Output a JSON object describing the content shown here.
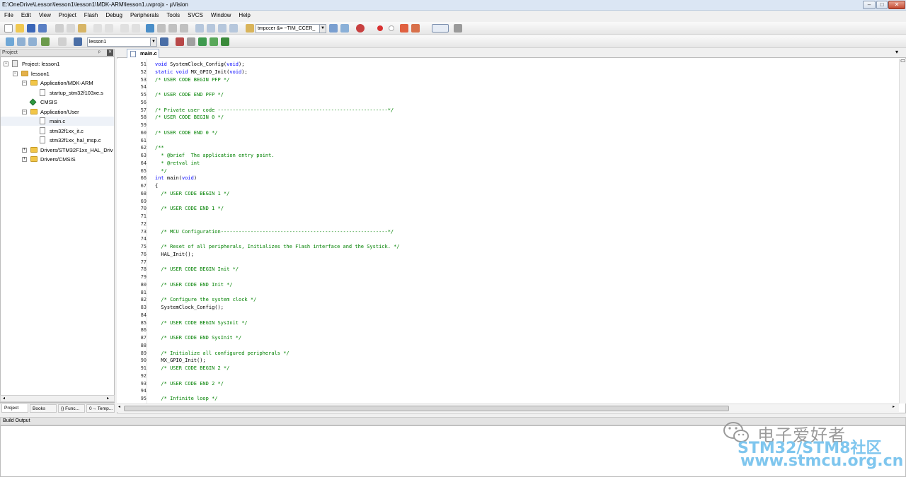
{
  "window": {
    "title": "E:\\OneDrive\\Lesson\\lesson1\\lesson1\\MDK-ARM\\lesson1.uvprojx - µVision",
    "min": "–",
    "max": "□",
    "close": "✕"
  },
  "menu": [
    "File",
    "Edit",
    "View",
    "Project",
    "Flash",
    "Debug",
    "Peripherals",
    "Tools",
    "SVCS",
    "Window",
    "Help"
  ],
  "toolbar": {
    "find_combo": "tmpccer &= ~TIM_CCER_",
    "target_combo": "lesson1"
  },
  "project_pane": {
    "title": "Project",
    "pin": "ᵖ",
    "close": "✕",
    "tree": [
      {
        "label": "Project: lesson1",
        "depth": 0,
        "exp": "−",
        "kind": "proj"
      },
      {
        "label": "lesson1",
        "depth": 1,
        "exp": "−",
        "kind": "target"
      },
      {
        "label": "Application/MDK-ARM",
        "depth": 2,
        "exp": "−",
        "kind": "folder"
      },
      {
        "label": "startup_stm32f103xe.s",
        "depth": 3,
        "exp": "",
        "kind": "file"
      },
      {
        "label": "CMSIS",
        "depth": 2,
        "exp": "",
        "kind": "gem"
      },
      {
        "label": "Application/User",
        "depth": 2,
        "exp": "−",
        "kind": "folder"
      },
      {
        "label": "main.c",
        "depth": 3,
        "exp": "",
        "kind": "file"
      },
      {
        "label": "stm32f1xx_it.c",
        "depth": 3,
        "exp": "",
        "kind": "file"
      },
      {
        "label": "stm32f1xx_hal_msp.c",
        "depth": 3,
        "exp": "",
        "kind": "file"
      },
      {
        "label": "Drivers/STM32F1xx_HAL_Driv",
        "depth": 2,
        "exp": "+",
        "kind": "folder"
      },
      {
        "label": "Drivers/CMSIS",
        "depth": 2,
        "exp": "+",
        "kind": "folder"
      }
    ],
    "tabs": [
      "Project",
      "Books",
      "{} Func...",
      "0→ Temp..."
    ]
  },
  "editor": {
    "tab": "main.c",
    "lines": [
      {
        "n": "51",
        "t": "void SystemClock_Config(void);",
        "c": "code"
      },
      {
        "n": "52",
        "t": "static void MX_GPIO_Init(void);",
        "c": "code"
      },
      {
        "n": "53",
        "t": "/* USER CODE BEGIN PFP */",
        "c": "cmt"
      },
      {
        "n": "54",
        "t": "",
        "c": "code"
      },
      {
        "n": "55",
        "t": "/* USER CODE END PFP */",
        "c": "cmt"
      },
      {
        "n": "56",
        "t": "",
        "c": "code"
      },
      {
        "n": "57",
        "t": "/* Private user code ---------------------------------------------------------*/",
        "c": "cmt"
      },
      {
        "n": "58",
        "t": "/* USER CODE BEGIN 0 */",
        "c": "cmt"
      },
      {
        "n": "59",
        "t": "",
        "c": "code"
      },
      {
        "n": "60",
        "t": "/* USER CODE END 0 */",
        "c": "cmt"
      },
      {
        "n": "61",
        "t": "",
        "c": "code"
      },
      {
        "n": "62",
        "t": "/**",
        "c": "cmt",
        "fold": "−"
      },
      {
        "n": "63",
        "t": "  * @brief  The application entry point.",
        "c": "cmt"
      },
      {
        "n": "64",
        "t": "  * @retval int",
        "c": "cmt"
      },
      {
        "n": "65",
        "t": "  */",
        "c": "cmt"
      },
      {
        "n": "66",
        "t": "int main(void)",
        "c": "code"
      },
      {
        "n": "67",
        "t": "{",
        "c": "code",
        "fold": "−"
      },
      {
        "n": "68",
        "t": "  /* USER CODE BEGIN 1 */",
        "c": "cmt"
      },
      {
        "n": "69",
        "t": "",
        "c": "code"
      },
      {
        "n": "70",
        "t": "  /* USER CODE END 1 */",
        "c": "cmt"
      },
      {
        "n": "71",
        "t": "",
        "c": "code"
      },
      {
        "n": "72",
        "t": "",
        "c": "code"
      },
      {
        "n": "73",
        "t": "  /* MCU Configuration--------------------------------------------------------*/",
        "c": "cmt"
      },
      {
        "n": "74",
        "t": "",
        "c": "code"
      },
      {
        "n": "75",
        "t": "  /* Reset of all peripherals, Initializes the Flash interface and the Systick. */",
        "c": "cmt"
      },
      {
        "n": "76",
        "t": "  HAL_Init();",
        "c": "code"
      },
      {
        "n": "77",
        "t": "",
        "c": "code"
      },
      {
        "n": "78",
        "t": "  /* USER CODE BEGIN Init */",
        "c": "cmt"
      },
      {
        "n": "79",
        "t": "",
        "c": "code"
      },
      {
        "n": "80",
        "t": "  /* USER CODE END Init */",
        "c": "cmt"
      },
      {
        "n": "81",
        "t": "",
        "c": "code"
      },
      {
        "n": "82",
        "t": "  /* Configure the system clock */",
        "c": "cmt"
      },
      {
        "n": "83",
        "t": "  SystemClock_Config();",
        "c": "code"
      },
      {
        "n": "84",
        "t": "",
        "c": "code"
      },
      {
        "n": "85",
        "t": "  /* USER CODE BEGIN SysInit */",
        "c": "cmt"
      },
      {
        "n": "86",
        "t": "",
        "c": "code"
      },
      {
        "n": "87",
        "t": "  /* USER CODE END SysInit */",
        "c": "cmt"
      },
      {
        "n": "88",
        "t": "",
        "c": "code"
      },
      {
        "n": "89",
        "t": "  /* Initialize all configured peripherals */",
        "c": "cmt"
      },
      {
        "n": "90",
        "t": "  MX_GPIO_Init();",
        "c": "code"
      },
      {
        "n": "91",
        "t": "  /* USER CODE BEGIN 2 */",
        "c": "cmt"
      },
      {
        "n": "92",
        "t": "",
        "c": "code"
      },
      {
        "n": "93",
        "t": "  /* USER CODE END 2 */",
        "c": "cmt"
      },
      {
        "n": "94",
        "t": "",
        "c": "code"
      },
      {
        "n": "95",
        "t": "  /* Infinite loop */",
        "c": "cmt"
      }
    ],
    "colors": {
      "comment": "#008000",
      "keyword": "#0000ff",
      "text": "#000000"
    }
  },
  "build_output": {
    "title": "Build Output"
  },
  "watermark": {
    "line1": "电子爱好者",
    "line2": "STM32/STM8社区",
    "line3": "www.stmcu.org.cn"
  }
}
